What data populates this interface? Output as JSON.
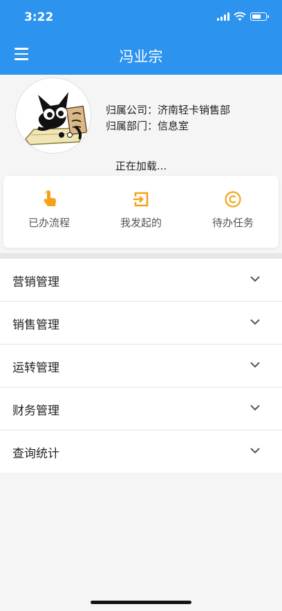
{
  "status_bar": {
    "time": "3:22"
  },
  "header": {
    "title": "冯业宗",
    "menu_icon": "hamburger-menu-icon"
  },
  "profile": {
    "company_label": "归属公司：",
    "company_value": "济南轻卡销售部",
    "department_label": "归属部门：",
    "department_value": "信息室",
    "loading_text": "正在加载..."
  },
  "quick_actions": [
    {
      "label": "已办流程",
      "icon": "hand-pointer-icon"
    },
    {
      "label": "我发起的",
      "icon": "sign-in-box-icon"
    },
    {
      "label": "待办任务",
      "icon": "copyright-circle-icon"
    }
  ],
  "menu": [
    {
      "label": "营销管理"
    },
    {
      "label": "销售管理"
    },
    {
      "label": "运转管理"
    },
    {
      "label": "财务管理"
    },
    {
      "label": "查询统计"
    }
  ],
  "colors": {
    "primary": "#2c93ef",
    "accent": "#f5a21a"
  }
}
